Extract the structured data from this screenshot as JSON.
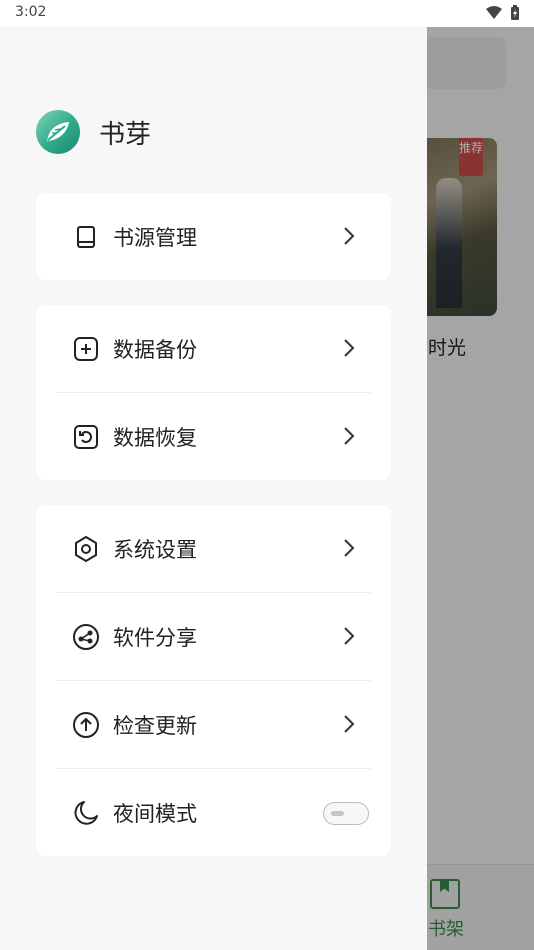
{
  "status_bar": {
    "time": "3:02"
  },
  "background": {
    "badge": "推荐",
    "book_title": "时光",
    "nav_label": "书架"
  },
  "app": {
    "name": "书芽"
  },
  "menu": {
    "book_source": "书源管理",
    "backup": "数据备份",
    "restore": "数据恢复",
    "settings": "系统设置",
    "share": "软件分享",
    "update": "检查更新",
    "night_mode": "夜间模式"
  },
  "night_mode_enabled": false,
  "colors": {
    "accent": "#2fa98a",
    "bookshelf_green": "#3c8a4a"
  }
}
